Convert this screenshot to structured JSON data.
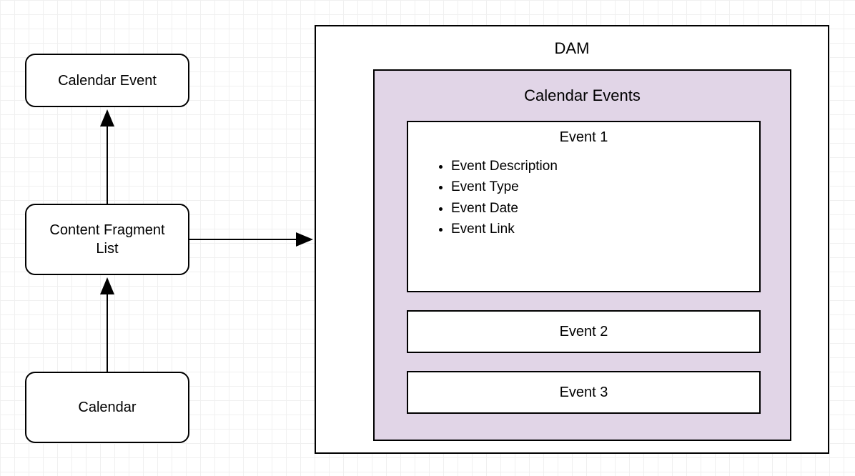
{
  "nodes": {
    "calendar_event": "Calendar Event",
    "content_fragment_list": "Content Fragment\nList",
    "calendar": "Calendar"
  },
  "dam": {
    "title": "DAM",
    "calendar_events": {
      "title": "Calendar Events",
      "event1": {
        "title": "Event 1",
        "props": [
          "Event Description",
          "Event Type",
          "Event Date",
          "Event Link"
        ]
      },
      "event2": "Event 2",
      "event3": "Event 3"
    }
  }
}
